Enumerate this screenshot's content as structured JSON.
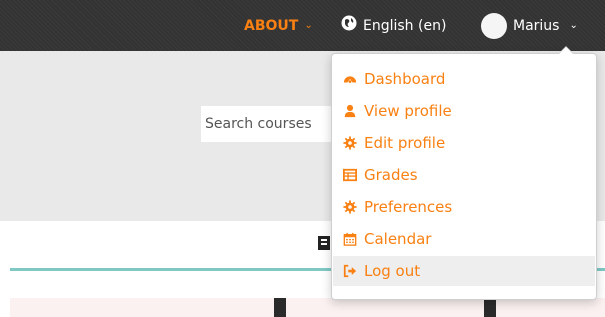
{
  "navbar": {
    "about_label": "ABOUT",
    "language_label": "English (en)",
    "user_name": "Marius",
    "chevron": "⌄"
  },
  "header": {
    "search_placeholder": "Search courses"
  },
  "user_menu": {
    "items": [
      {
        "label": "Dashboard",
        "icon": "dashboard-icon"
      },
      {
        "label": "View profile",
        "icon": "user-icon"
      },
      {
        "label": "Edit profile",
        "icon": "cog-icon"
      },
      {
        "label": "Grades",
        "icon": "table-icon"
      },
      {
        "label": "Preferences",
        "icon": "cog-icon"
      },
      {
        "label": "Calendar",
        "icon": "calendar-icon"
      },
      {
        "label": "Log out",
        "icon": "sign-out-icon"
      }
    ]
  },
  "colors": {
    "accent": "#f98012",
    "navbar_bg": "#333333",
    "header_bg": "#e9e9e9",
    "teal_rule": "#7fc8c4"
  }
}
